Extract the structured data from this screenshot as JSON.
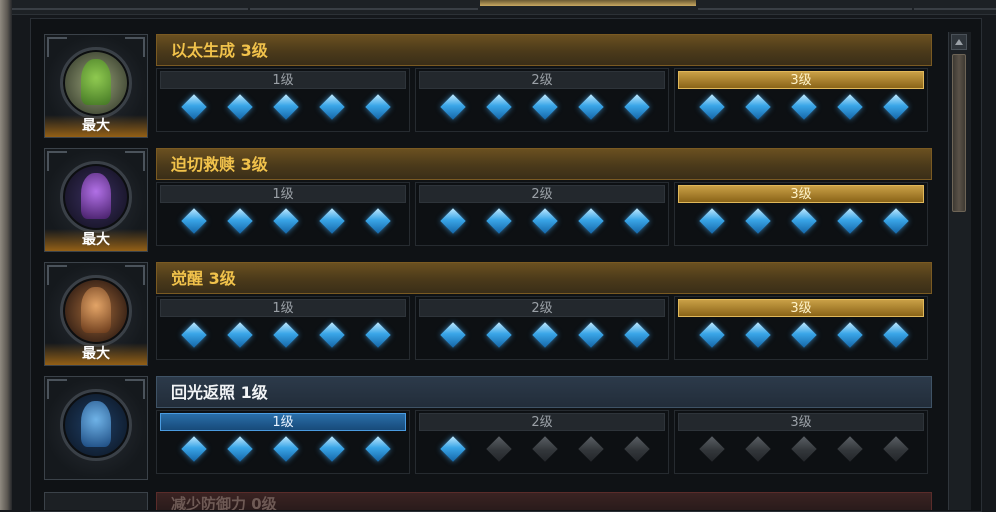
{
  "cards": [
    {
      "title": "以太生成 3级",
      "portrait_label": "最大",
      "icon": "aether-generation-icon",
      "theme": "gold",
      "levels": [
        "1级",
        "2级",
        "3级"
      ],
      "current_level": 3,
      "gems_lit": [
        5,
        5,
        5
      ]
    },
    {
      "title": "迫切救赎 3级",
      "portrait_label": "最大",
      "icon": "urgent-redemption-icon",
      "theme": "gold",
      "levels": [
        "1级",
        "2级",
        "3级"
      ],
      "current_level": 3,
      "gems_lit": [
        5,
        5,
        5
      ]
    },
    {
      "title": "觉醒 3级",
      "portrait_label": "最大",
      "icon": "awakening-icon",
      "theme": "gold",
      "levels": [
        "1级",
        "2级",
        "3级"
      ],
      "current_level": 3,
      "gems_lit": [
        5,
        5,
        5
      ]
    },
    {
      "title": "回光返照 1级",
      "portrait_label": "",
      "icon": "last-glow-icon",
      "theme": "blue",
      "levels": [
        "1级",
        "2级",
        "3级"
      ],
      "current_level": 1,
      "gems_lit": [
        5,
        1,
        0
      ]
    }
  ],
  "next_card_partial_title": "减少防御力 0级",
  "colors": {
    "gold_accent": "#f1c24b",
    "blue_accent": "#2a6ea8",
    "gem_on": "#3aa6e8",
    "gem_off": "#3a3e42"
  }
}
